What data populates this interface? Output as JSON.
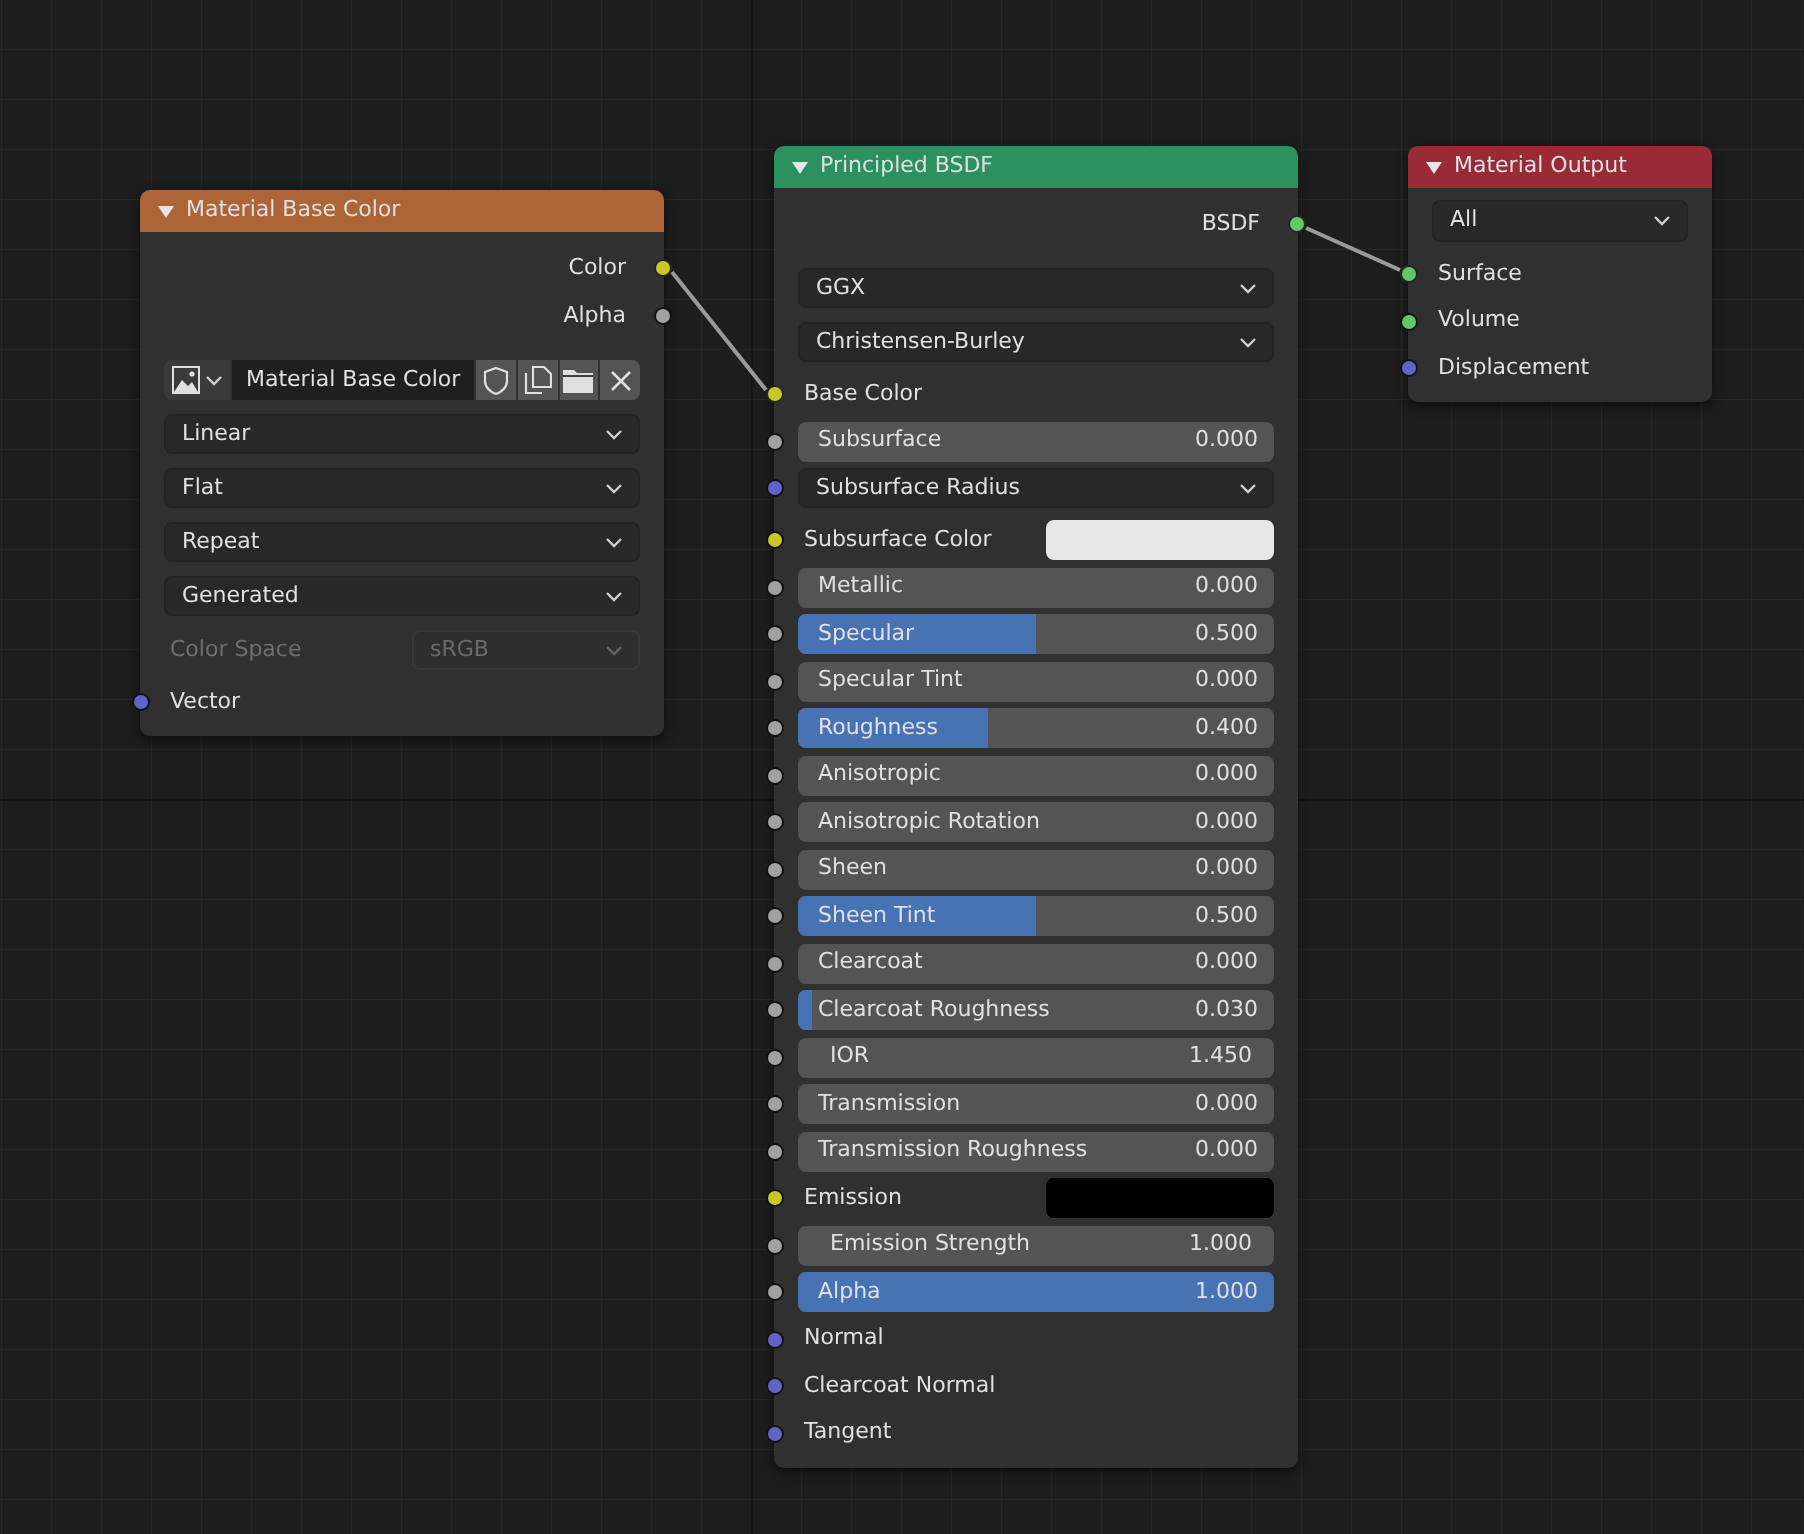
{
  "nodes": [
    {
      "title": "Material Base Color",
      "color": "#ad6437",
      "rows": [
        {
          "kind": "output",
          "label": "Color",
          "color": "#c7c729",
          "connected": true
        },
        {
          "kind": "output",
          "label": "Alpha",
          "color": "#a1a1a1",
          "connected": false
        },
        {
          "kind": "image",
          "name": "Material Base Color"
        },
        {
          "kind": "dropdown",
          "value": "Linear"
        },
        {
          "kind": "dropdown",
          "value": "Flat"
        },
        {
          "kind": "dropdown",
          "value": "Repeat"
        },
        {
          "kind": "dropdown",
          "value": "Generated"
        },
        {
          "kind": "property",
          "label": "Color Space",
          "value": "sRGB",
          "disabled": true
        },
        {
          "kind": "input",
          "label": "Vector",
          "color": "#6363c7"
        }
      ]
    },
    {
      "title": "Principled BSDF",
      "color": "#2b9160",
      "rows": [
        {
          "kind": "output",
          "label": "BSDF",
          "color": "#63c763",
          "connected": true
        },
        {
          "kind": "dropdown",
          "value": "GGX"
        },
        {
          "kind": "dropdown",
          "value": "Christensen-Burley"
        },
        {
          "kind": "input",
          "label": "Base Color",
          "color": "#c7c729",
          "connected": true
        },
        {
          "kind": "slider",
          "label": "Subsurface",
          "value": "0.000",
          "level": 0,
          "color": "#a1a1a1"
        },
        {
          "kind": "dropdown",
          "value": "Subsurface Radius",
          "color": "#6363c7"
        },
        {
          "kind": "swatch",
          "label": "Subsurface Color",
          "swatch": {
            "color": "#e8e8e8"
          },
          "color": "#c7c729"
        },
        {
          "kind": "slider",
          "label": "Metallic",
          "value": "0.000",
          "level": 0,
          "color": "#a1a1a1"
        },
        {
          "kind": "slider",
          "label": "Specular",
          "value": "0.500",
          "level": 0.5,
          "color": "#a1a1a1"
        },
        {
          "kind": "slider",
          "label": "Specular Tint",
          "value": "0.000",
          "level": 0,
          "color": "#a1a1a1"
        },
        {
          "kind": "slider",
          "label": "Roughness",
          "value": "0.400",
          "level": 0.4,
          "color": "#a1a1a1"
        },
        {
          "kind": "slider",
          "label": "Anisotropic",
          "value": "0.000",
          "level": 0,
          "color": "#a1a1a1"
        },
        {
          "kind": "slider",
          "label": "Anisotropic Rotation",
          "value": "0.000",
          "level": 0,
          "color": "#a1a1a1"
        },
        {
          "kind": "slider",
          "label": "Sheen",
          "value": "0.000",
          "level": 0,
          "color": "#a1a1a1"
        },
        {
          "kind": "slider",
          "label": "Sheen Tint",
          "value": "0.500",
          "level": 0.5,
          "color": "#a1a1a1"
        },
        {
          "kind": "slider",
          "label": "Clearcoat",
          "value": "0.000",
          "level": 0,
          "color": "#a1a1a1"
        },
        {
          "kind": "slider",
          "label": "Clearcoat Roughness",
          "value": "0.030",
          "level": 0.03,
          "color": "#a1a1a1"
        },
        {
          "kind": "number",
          "label": "IOR",
          "value": "1.450",
          "color": "#a1a1a1"
        },
        {
          "kind": "slider",
          "label": "Transmission",
          "value": "0.000",
          "level": 0,
          "color": "#a1a1a1"
        },
        {
          "kind": "slider",
          "label": "Transmission Roughness",
          "value": "0.000",
          "level": 0,
          "color": "#a1a1a1"
        },
        {
          "kind": "swatch",
          "label": "Emission",
          "swatch": {
            "color": "#000000"
          },
          "color": "#c7c729"
        },
        {
          "kind": "number",
          "label": "Emission Strength",
          "value": "1.000",
          "color": "#a1a1a1"
        },
        {
          "kind": "slider",
          "label": "Alpha",
          "value": "1.000",
          "level": 1,
          "color": "#a1a1a1"
        },
        {
          "kind": "input",
          "label": "Normal",
          "color": "#6363c7",
          "connected": false
        },
        {
          "kind": "input",
          "label": "Clearcoat Normal",
          "color": "#6363c7",
          "connected": false
        },
        {
          "kind": "input",
          "label": "Tangent",
          "color": "#6363c7",
          "connected": false
        }
      ]
    },
    {
      "title": "Material Output",
      "color": "#9a2b36",
      "rows": [
        {
          "kind": "dropdown",
          "value": "All"
        },
        {
          "kind": "input",
          "label": "Surface",
          "color": "#63c763",
          "connected": true
        },
        {
          "kind": "input",
          "label": "Volume",
          "color": "#63c763",
          "connected": false
        },
        {
          "kind": "input",
          "label": "Displacement",
          "color": "#6363c7",
          "connected": false
        }
      ]
    }
  ]
}
